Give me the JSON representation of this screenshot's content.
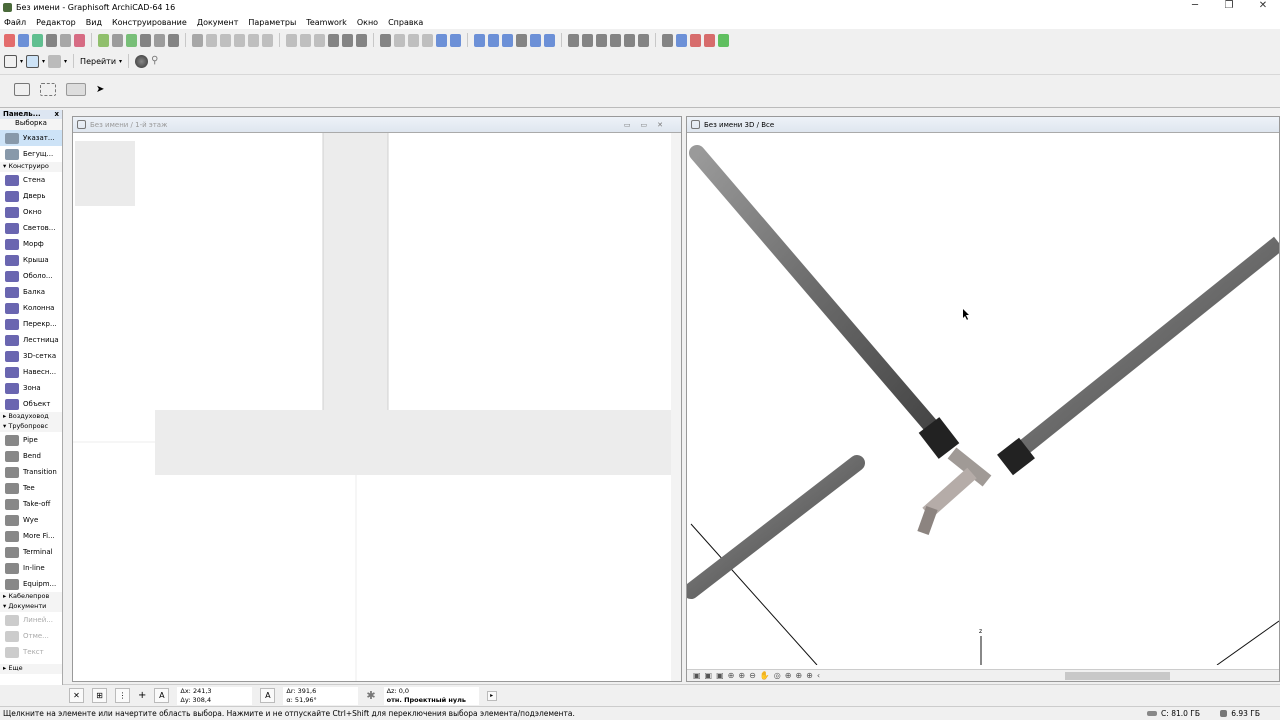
{
  "window": {
    "title": "Без имени - Graphisoft ArchiCAD-64 16",
    "minimize": "─",
    "restore": "❐",
    "close": "✕"
  },
  "menu": [
    "Файл",
    "Редактор",
    "Вид",
    "Конструирование",
    "Документ",
    "Параметры",
    "Teamwork",
    "Окно",
    "Справка"
  ],
  "toolbar2": {
    "goto_label": "Перейти"
  },
  "toolbox": {
    "title": "Панель...",
    "close": "x",
    "section_select": "Выборка",
    "select_items": [
      "Указат...",
      "Бегущ..."
    ],
    "group_design": "Конструиро",
    "design_items": [
      "Стена",
      "Дверь",
      "Окно",
      "Светов...",
      "Морф",
      "Крыша",
      "Оболо...",
      "Балка",
      "Колонна",
      "Перекр...",
      "Лестница",
      "3D-сетка",
      "Навесн...",
      "Зона",
      "Объект"
    ],
    "group_ducts": "Воздуховод",
    "group_pipes": "Трубопровс",
    "pipe_items": [
      "Pipe",
      "Bend",
      "Transition",
      "Tee",
      "Take-off",
      "Wye",
      "More Fi...",
      "Terminal",
      "In-line",
      "Equipm..."
    ],
    "group_cables": "Кабелепров",
    "group_docs": "Документи",
    "doc_items": [
      "Линей...",
      "Отме...",
      "Текст"
    ],
    "more": "Еще"
  },
  "plan_window": {
    "title": "Без имени / 1-й этаж"
  },
  "view3d_window": {
    "title": "Без имени 3D / Все",
    "axis_label": "z"
  },
  "coords": {
    "dx": "Δx: 241,3",
    "dy": "Δy: 308,4",
    "dr": "Δr: 391,6",
    "angle": "α: 51,96°",
    "dz": "Δz: 0,0",
    "ref": "отн. Проектный нуль"
  },
  "status": {
    "message": "Щелкните на элементе или начертите область выбора. Нажмите и не отпускайте Ctrl+Shift для переключения выбора элемента/подэлемента.",
    "disk": "C: 81.0 ГБ",
    "memory": "6.93 ГБ"
  }
}
